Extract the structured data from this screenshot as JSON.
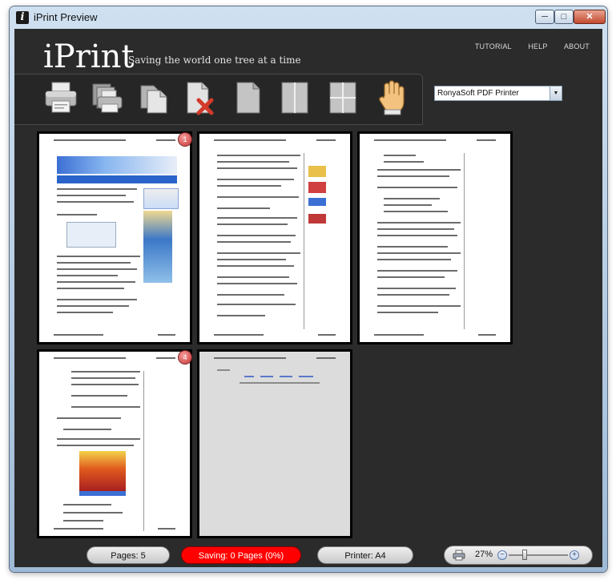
{
  "window": {
    "title": "iPrint Preview"
  },
  "header": {
    "logo": "iPrint",
    "tagline": "Saving the world one tree at a time",
    "nav": [
      "TUTORIAL",
      "HELP",
      "ABOUT"
    ]
  },
  "toolbar": {
    "tools": [
      "print-icon",
      "print-multiple-icon",
      "copy-pages-icon",
      "delete-page-icon",
      "page-single-icon",
      "page-two-column-icon",
      "page-four-grid-icon",
      "hand-pan-icon"
    ]
  },
  "printer": {
    "selected": "RonyaSoft PDF Printer"
  },
  "pages": [
    {
      "badge": "1"
    },
    {
      "badge": ""
    },
    {
      "badge": ""
    },
    {
      "badge": "4"
    },
    {
      "badge": ""
    }
  ],
  "status": {
    "pages": "Pages: 5",
    "saving": "Saving: 0 Pages (0%)",
    "printer": "Printer: A4",
    "zoom": "27%",
    "zoom_level": 0.27
  },
  "colors": {
    "background": "#2b2b2b",
    "saving": "#ff0000",
    "accent": "#5a78a8"
  }
}
